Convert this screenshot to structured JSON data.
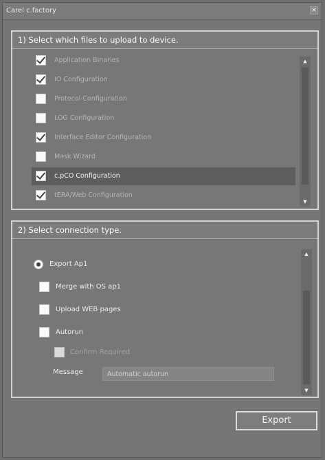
{
  "window": {
    "title": "Carel c.factory",
    "close_icon": "close-icon",
    "close_glyph": "×"
  },
  "files_group": {
    "title": "1) Select which files to upload to device.",
    "items": [
      {
        "label": "Application Binaries",
        "checked": true,
        "selected": false
      },
      {
        "label": "IO Configuration",
        "checked": true,
        "selected": false
      },
      {
        "label": "Protocol Configuration",
        "checked": false,
        "selected": false
      },
      {
        "label": "LOG Configuration",
        "checked": false,
        "selected": false
      },
      {
        "label": "Interface Editor Configuration",
        "checked": true,
        "selected": false
      },
      {
        "label": "Mask Wizard",
        "checked": false,
        "selected": false
      },
      {
        "label": "c.pCO Configuration",
        "checked": true,
        "selected": true
      },
      {
        "label": "tERA/Web Configuration",
        "checked": true,
        "selected": false
      }
    ],
    "scroll_up_glyph": "▲",
    "scroll_down_glyph": "▼"
  },
  "connection_group": {
    "title": "2) Select connection type.",
    "export_ap1": {
      "label": "Export Ap1",
      "selected": true
    },
    "merge_os": {
      "label": "Merge with OS ap1",
      "checked": false
    },
    "upload_web": {
      "label": "Upload WEB pages",
      "checked": false
    },
    "autorun": {
      "label": "Autorun",
      "checked": false
    },
    "confirm_required": {
      "label": "Confirm Required",
      "checked": false,
      "disabled": true
    },
    "message_label": "Message",
    "message_value": "Automatic autorun",
    "scroll_up_glyph": "▲",
    "scroll_down_glyph": "▼"
  },
  "footer": {
    "export_label": "Export"
  }
}
